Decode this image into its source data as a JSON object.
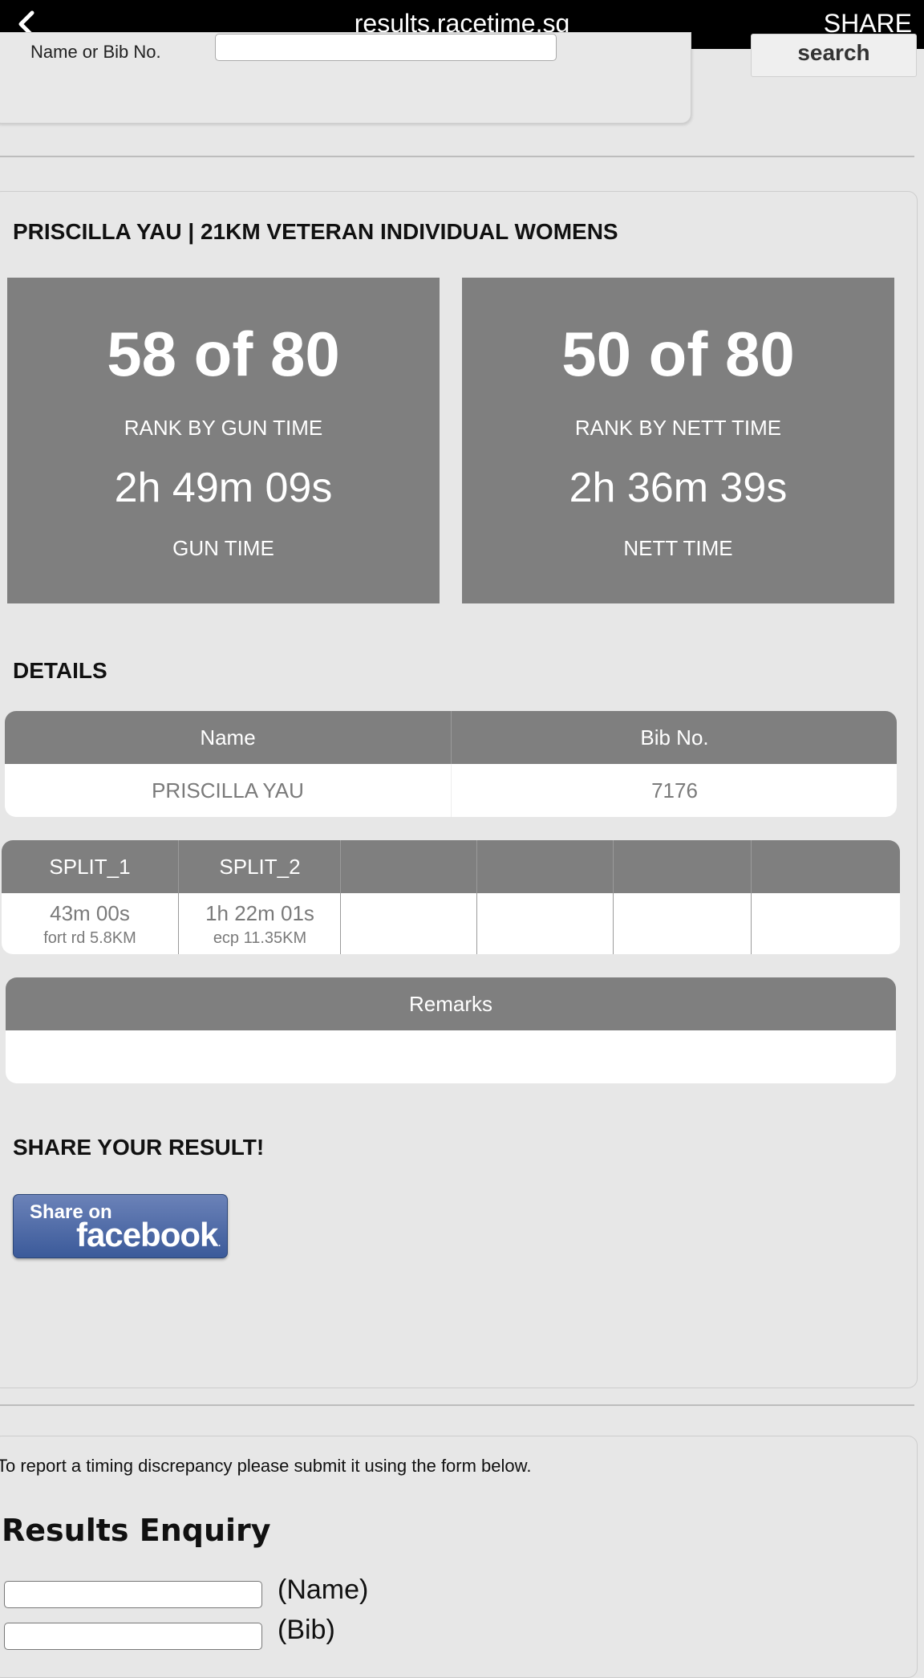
{
  "topbar": {
    "url": "results.racetime.sg",
    "share_label": "SHARE",
    "back_icon": "chevron-left-icon"
  },
  "search": {
    "label": "Name or Bib No.",
    "button_label": "search",
    "value": ""
  },
  "result": {
    "title": "PRISCILLA YAU | 21KM VETERAN INDIVIDUAL WOMENS",
    "gun": {
      "rank": "58 of 80",
      "rank_label": "RANK BY GUN TIME",
      "time": "2h 49m 09s",
      "time_label": "GUN TIME"
    },
    "nett": {
      "rank": "50 of 80",
      "rank_label": "RANK BY NETT TIME",
      "time": "2h 36m 39s",
      "time_label": "NETT TIME"
    }
  },
  "details": {
    "heading": "DETAILS",
    "headers": [
      "Name",
      "Bib No."
    ],
    "values": [
      "PRISCILLA YAU",
      "7176"
    ]
  },
  "splits": [
    {
      "label": "SPLIT_1",
      "time": "43m 00s",
      "location": "fort rd 5.8KM"
    },
    {
      "label": "SPLIT_2",
      "time": "1h 22m 01s",
      "location": "ecp 11.35KM"
    },
    {
      "label": "",
      "time": "",
      "location": ""
    },
    {
      "label": "",
      "time": "",
      "location": ""
    },
    {
      "label": "",
      "time": "",
      "location": ""
    },
    {
      "label": "",
      "time": "",
      "location": ""
    }
  ],
  "remarks": {
    "header": "Remarks",
    "value": ""
  },
  "share": {
    "heading": "SHARE YOUR RESULT!",
    "fb_share_on": "Share on",
    "fb_facebook": "facebook",
    "fb_dot": "."
  },
  "enquiry": {
    "report_text": "To report a timing discrepancy please submit it using the form below.",
    "title": "Results Enquiry",
    "name_label": "(Name)",
    "bib_label": "(Bib)"
  }
}
